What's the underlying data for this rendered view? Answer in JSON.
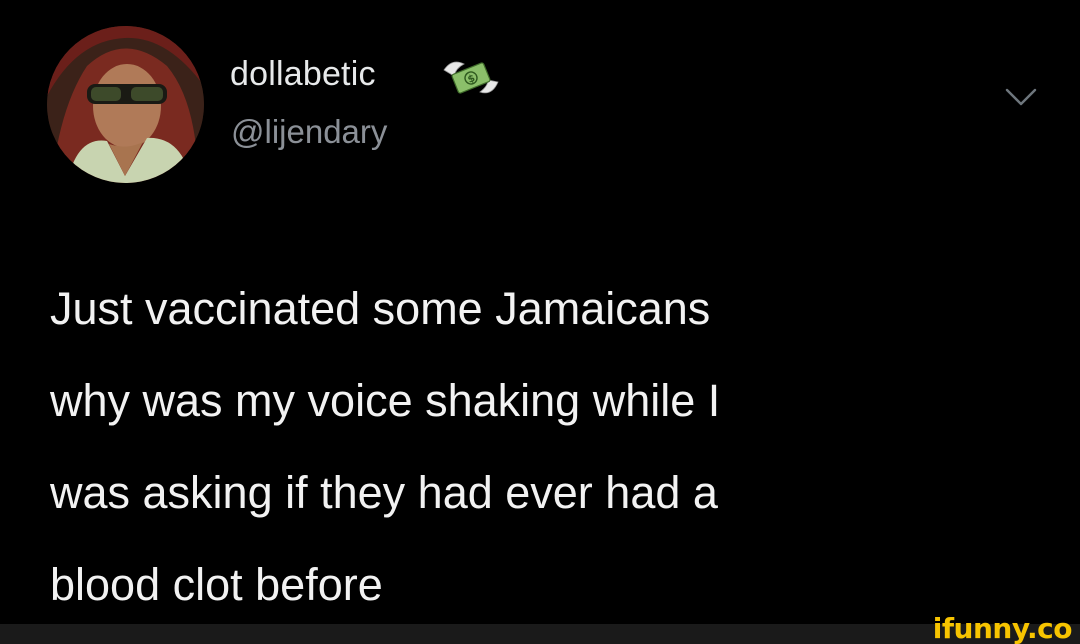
{
  "tweet": {
    "display_name": "dollabetic",
    "handle": "@lijendary",
    "name_emoji_icon": "money-with-wings-icon",
    "menu_icon": "chevron-down-icon",
    "text": "Just vaccinated some Jamaicans\nwhy was my voice shaking while I\nwas asking if they had ever had a\nblood clot before"
  },
  "watermark": {
    "text": "ifunny.co",
    "color": "#f7c400"
  },
  "colors": {
    "background": "#000000",
    "text_primary": "#f2f2f2",
    "text_secondary": "#8b9097"
  }
}
